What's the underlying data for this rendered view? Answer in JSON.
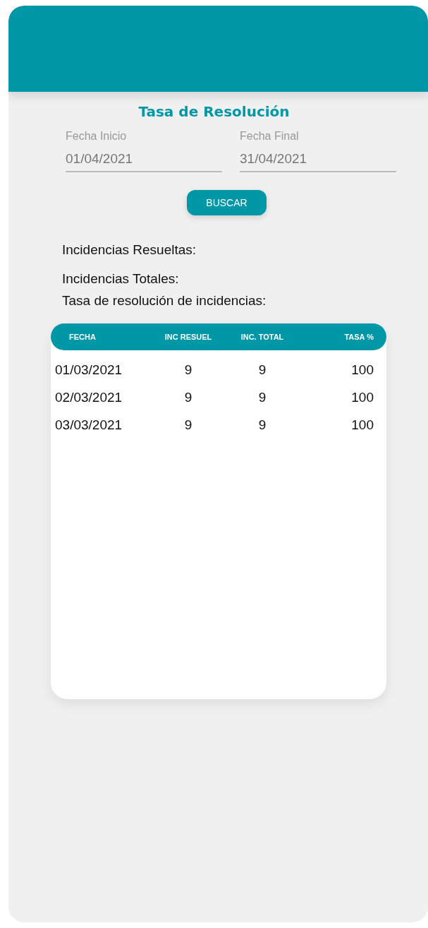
{
  "title": "Tasa de Resolución",
  "fields": [
    {
      "label": "Fecha Inicio",
      "value": "01/04/2021"
    },
    {
      "label": "Fecha Final",
      "value": "31/04/2021"
    }
  ],
  "search_button": "BUSCAR",
  "summary": [
    "Incidencias Resueltas:",
    "Incidencias Totales:",
    "Tasa de resolución de incidencias:"
  ],
  "table": {
    "columns": [
      "FECHA",
      "INC RESUEL",
      "INC. TOTAL",
      "TASA %"
    ],
    "rows": [
      [
        "01/03/2021",
        "9",
        "9",
        "100"
      ],
      [
        "02/03/2021",
        "9",
        "9",
        "100"
      ],
      [
        "03/03/2021",
        "9",
        "9",
        "100"
      ]
    ]
  }
}
